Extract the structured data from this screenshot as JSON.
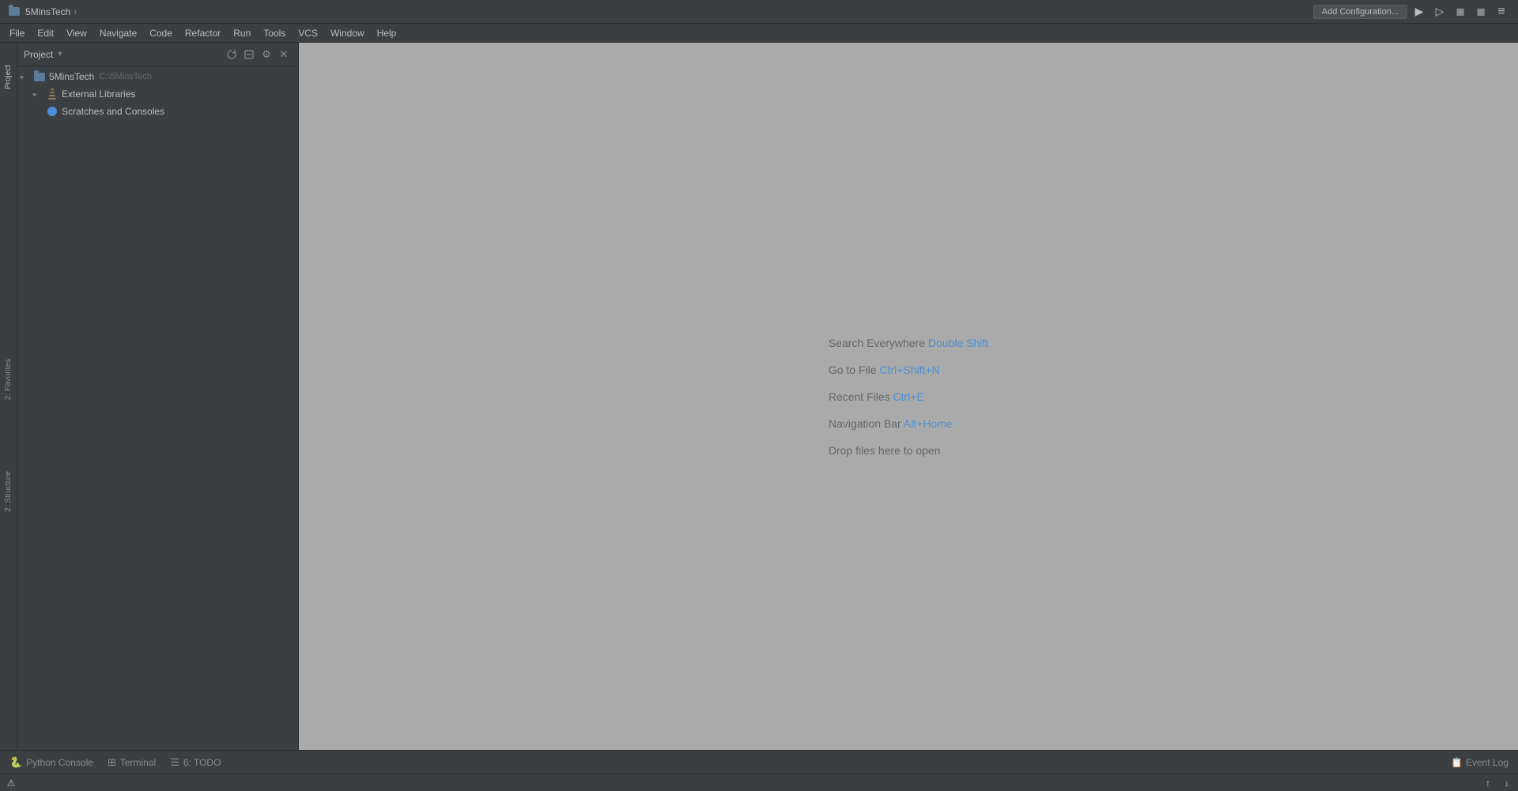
{
  "window": {
    "title": "5MinsTech",
    "breadcrumb_arrow": "›"
  },
  "titlebar": {
    "add_config_label": "Add Configuration...",
    "icons": [
      "▶",
      "▶",
      "◼",
      "◼",
      "≡"
    ]
  },
  "menubar": {
    "items": [
      "File",
      "Edit",
      "View",
      "Navigate",
      "Code",
      "Refactor",
      "Run",
      "Tools",
      "VCS",
      "Window",
      "Help"
    ]
  },
  "sidebar_left": {
    "tabs": [
      {
        "id": "project",
        "label": "Project",
        "active": true
      },
      {
        "id": "favorites",
        "label": "2: Favorites",
        "active": false
      },
      {
        "id": "structure",
        "label": "2: Structure",
        "active": false
      }
    ]
  },
  "project_panel": {
    "title": "Project",
    "dropdown_arrow": "▾",
    "icons": {
      "sync": "⟳",
      "collapse": "⊟",
      "gear": "⚙",
      "close": "✕"
    },
    "tree": [
      {
        "id": "5minstech",
        "label": "5MinsTech",
        "sublabel": "C:\\5MinsTech",
        "level": 0,
        "type": "project-folder",
        "expanded": true
      },
      {
        "id": "external-libraries",
        "label": "External Libraries",
        "level": 1,
        "type": "libraries",
        "expanded": false
      },
      {
        "id": "scratches",
        "label": "Scratches and Consoles",
        "level": 1,
        "type": "scratches",
        "expanded": false
      }
    ]
  },
  "editor": {
    "welcome_lines": [
      {
        "text": "Search Everywhere",
        "shortcut": "Double Shift"
      },
      {
        "text": "Go to File",
        "shortcut": "Ctrl+Shift+N"
      },
      {
        "text": "Recent Files",
        "shortcut": "Ctrl+E"
      },
      {
        "text": "Navigation Bar",
        "shortcut": "Alt+Home"
      },
      {
        "text": "Drop files here to open",
        "shortcut": null
      }
    ]
  },
  "bottom_bar": {
    "tabs": [
      {
        "id": "python-console",
        "label": "Python Console",
        "icon": "🐍",
        "active": false
      },
      {
        "id": "terminal",
        "label": "Terminal",
        "icon": "⊞",
        "active": false
      },
      {
        "id": "todo",
        "label": "6: TODO",
        "icon": "☰",
        "active": false
      }
    ],
    "event_log": "Event Log"
  },
  "status_bar": {
    "left_icon": "⚠",
    "right_icons": [
      "↑",
      "↓"
    ]
  }
}
